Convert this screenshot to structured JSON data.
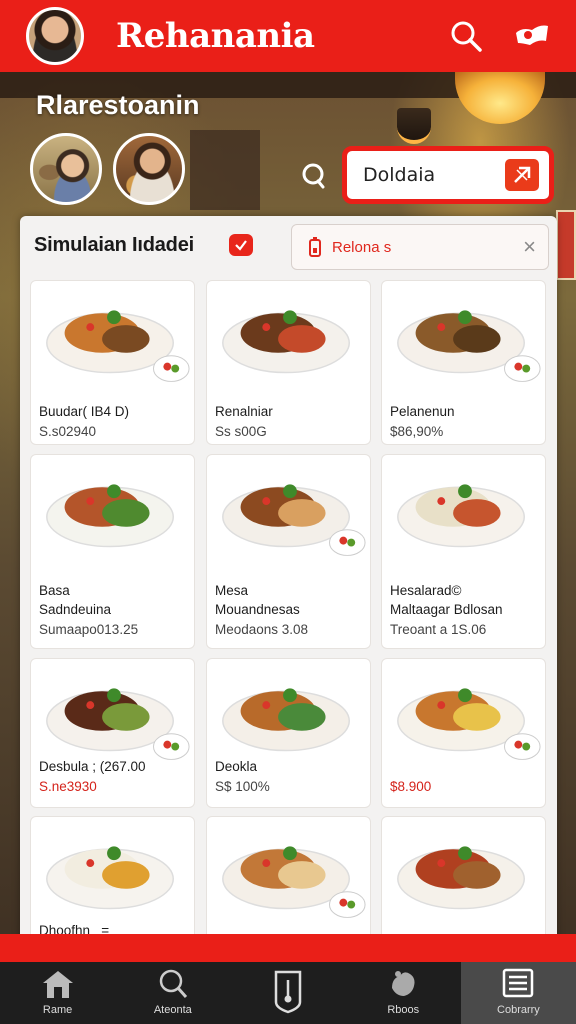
{
  "app": {
    "title": "Rehanania"
  },
  "restaurant": {
    "name": "Rlarestoanin"
  },
  "search": {
    "value": "Doldaia"
  },
  "panel": {
    "title": "Simulaian Iıdadei",
    "filter_label": "Relona  s"
  },
  "items": [
    {
      "name": "Buudar( IB4 D)",
      "price": "S.s02940",
      "price_color": "#444444"
    },
    {
      "name": "Renalniar",
      "price": "Ss s00G",
      "price_color": "#444444"
    },
    {
      "name": "Pelanenun",
      "price": "$86,90%",
      "price_color": "#444444"
    },
    {
      "name": "Basa\nSadndeuina",
      "price": "Sumaapo013.25",
      "price_color": "#444444"
    },
    {
      "name": "Mesa\nMouandnesas",
      "price": "Meodaons 3.08",
      "price_color": "#444444"
    },
    {
      "name": "Hesalarad©\nMaltaagar Bdlosan",
      "price": "Treoant a 1S.06",
      "price_color": "#444444"
    },
    {
      "name": "Desbula ; (267.00",
      "price": "S.ne3930",
      "price_color": "#d4231b"
    },
    {
      "name": "Deokla",
      "price": "S$ 100%",
      "price_color": "#444444"
    },
    {
      "name": "",
      "price": "$8.900",
      "price_color": "#d4231b"
    },
    {
      "name": "Dhoofhn   =",
      "price": "",
      "price_color": "#444444"
    },
    {
      "name": "",
      "price": "",
      "price_color": "#444444"
    },
    {
      "name": "",
      "price": "",
      "price_color": "#444444"
    }
  ],
  "nav": [
    {
      "label": "Rame",
      "icon": "home-icon"
    },
    {
      "label": "Ateonta",
      "icon": "search-icon"
    },
    {
      "label": "",
      "icon": "thermometer-icon"
    },
    {
      "label": "Rboos",
      "icon": "hand-icon"
    },
    {
      "label": "Cobrarry",
      "icon": "menu-list-icon"
    }
  ],
  "colors": {
    "brand_red": "#ea1f18",
    "panel": "#f3f2f1",
    "nav_bg": "#1e1e1e"
  }
}
